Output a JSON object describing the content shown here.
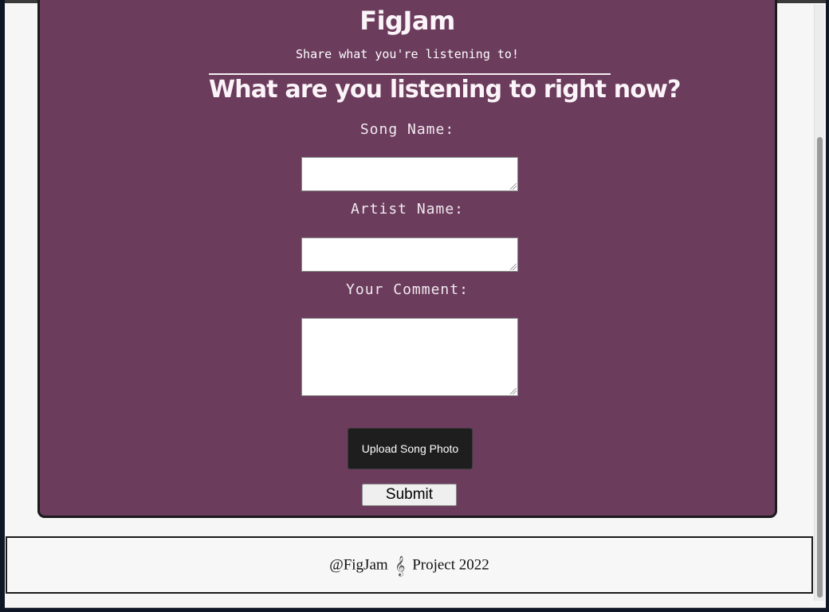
{
  "header": {
    "brand": "FigJam",
    "tagline": "Share what you're listening to!"
  },
  "form": {
    "heading": "What are you listening to right now?",
    "song_label": "Song Name:",
    "song_value": "",
    "artist_label": "Artist Name:",
    "artist_value": "",
    "comment_label": "Your Comment:",
    "comment_value": "",
    "upload_label": "Upload Song Photo",
    "submit_label": "Submit"
  },
  "footer": {
    "prefix": "@FigJam",
    "icon": "treble-clef-icon",
    "icon_glyph": "𝄞",
    "suffix": "Project 2022"
  },
  "colors": {
    "card_background": "#6b3c5c",
    "page_background": "#f6f6f6",
    "upload_button": "#1e1e1e"
  }
}
